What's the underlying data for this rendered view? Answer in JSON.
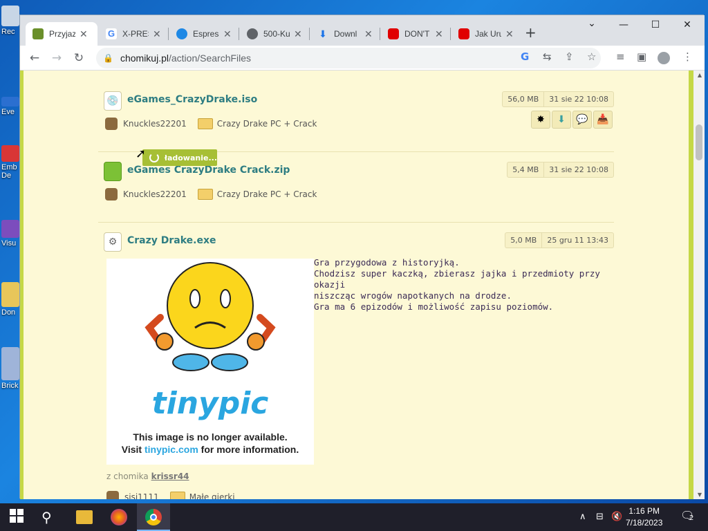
{
  "desktop": {
    "icons": [
      {
        "label": "Rec"
      },
      {
        "label": "Eve"
      },
      {
        "label": "Emb De"
      },
      {
        "label": "Visu"
      },
      {
        "label": "Don"
      },
      {
        "label": "Brick"
      }
    ]
  },
  "browser": {
    "tabs": [
      {
        "title": "Przyjaz",
        "color": "#6a8f2a",
        "active": true
      },
      {
        "title": "X-PRES",
        "color": "#4285f4"
      },
      {
        "title": "Espress",
        "color": "#1e88e5"
      },
      {
        "title": "500-Ku",
        "color": "#5f6368"
      },
      {
        "title": "Downl",
        "color": "#1a73e8"
      },
      {
        "title": "DON'T",
        "color": "#e00000"
      },
      {
        "title": "Jak Uru",
        "color": "#e00000"
      }
    ],
    "new_tab_label": "+",
    "url_host": "chomikuj.pl",
    "url_path": "/action/SearchFiles"
  },
  "page": {
    "files": [
      {
        "name": "eGames_CrazyDrake.iso",
        "size": "56,0 MB",
        "date": "31 sie 22 10:08",
        "owner": "Knuckles22201",
        "folder": "Crazy Drake PC + Crack",
        "icon": "disc-icon"
      },
      {
        "name": "eGames CrazyDrake Crack.zip",
        "size": "5,4 MB",
        "date": "31 sie 22 10:08",
        "owner": "Knuckles22201",
        "folder": "Crazy Drake PC + Crack",
        "icon": "archive-icon"
      },
      {
        "name": "Crazy Drake.exe",
        "size": "5,0 MB",
        "date": "25 gru 11 13:43",
        "icon": "gear-icon"
      }
    ],
    "loading_label": "ładowanie...",
    "description_lines": [
      "Gra przygodowa z historyjką.",
      "Chodzisz super kaczką, zbierasz jajka i przedmioty przy okazji",
      "niszcząc wrogów napotkanych na drodze.",
      "Gra ma 6 epizodów i możliwość zapisu poziomów."
    ],
    "image": {
      "brand": "tinypic",
      "line1": "This image is no longer available.",
      "line2_pre": "Visit ",
      "line2_link": "tinypic.com",
      "line2_post": " for more information."
    },
    "from_label": "z chomika",
    "from_user": "krissr44",
    "next_owner": "sisi1111",
    "next_folder": "Małe gierki"
  },
  "taskbar": {
    "time": "1:16 PM",
    "date": "7/18/2023",
    "notification_count": "2"
  }
}
